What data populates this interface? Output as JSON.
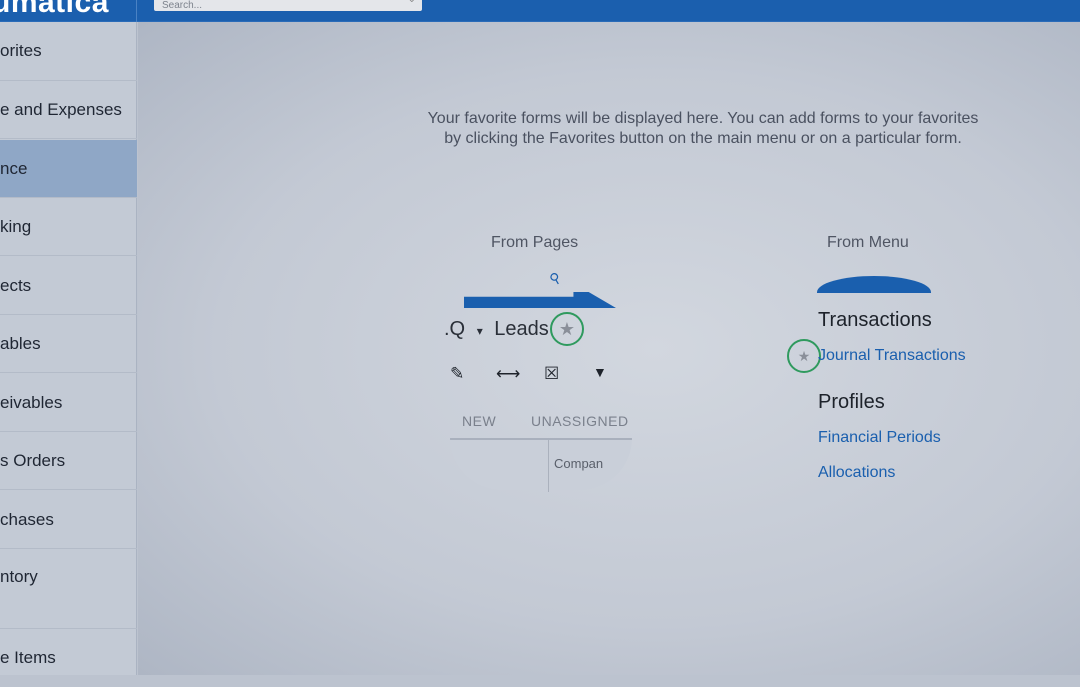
{
  "header": {
    "logo": "umatica",
    "search_placeholder": "Search..."
  },
  "sidebar": {
    "items": [
      {
        "label": "orites"
      },
      {
        "label": "e and Expenses"
      },
      {
        "label": "nce",
        "active": true
      },
      {
        "label": "king"
      },
      {
        "label": "ects"
      },
      {
        "label": "ables"
      },
      {
        "label": "eivables"
      },
      {
        "label": "s Orders"
      },
      {
        "label": "chases"
      },
      {
        "label": "ntory"
      },
      {
        "label": "e Items"
      }
    ]
  },
  "main": {
    "message_line1": "Your favorite forms will be displayed here. You can add forms to your favorites",
    "message_line2": "by clicking the Favorites button on the main menu or on a particular form.",
    "from_pages": {
      "title": "From Pages",
      "prefix": ".Q",
      "caret": "▾",
      "screen": "Leads",
      "star": "★",
      "tools": [
        "✎",
        "⟷",
        "☒",
        "▼"
      ],
      "tabs": [
        "NEW",
        "UNASSIGNED"
      ],
      "column": "Compan"
    },
    "from_menu": {
      "title": "From Menu",
      "sections": [
        {
          "title": "Transactions",
          "links": [
            "Journal Transactions"
          ]
        },
        {
          "title": "Profiles",
          "links": [
            "Financial Periods",
            "Allocations"
          ]
        }
      ],
      "star": "★"
    }
  },
  "colors": {
    "brand": "#1b5fae",
    "highlight": "#2f9a5e"
  }
}
